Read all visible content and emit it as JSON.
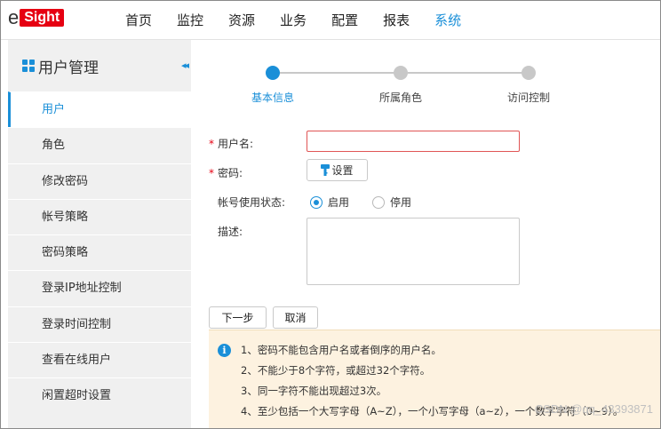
{
  "app": {
    "logo_prefix": "e",
    "logo_box": "Sight"
  },
  "nav": {
    "items": [
      "首页",
      "监控",
      "资源",
      "业务",
      "配置",
      "报表",
      "系统"
    ],
    "active_index": 6
  },
  "sidebar": {
    "title": "用户管理",
    "collapse_glyph": "◂◂",
    "items": [
      "用户",
      "角色",
      "修改密码",
      "帐号策略",
      "密码策略",
      "登录IP地址控制",
      "登录时间控制",
      "查看在线用户",
      "闲置超时设置"
    ],
    "active_index": 0
  },
  "steps": {
    "items": [
      "基本信息",
      "所属角色",
      "访问控制"
    ],
    "active_index": 0
  },
  "form": {
    "required_mark": "*",
    "username_label": "用户名:",
    "username_value": "",
    "password_label": "密码:",
    "set_button_label": "设置",
    "status_label": "帐号使用状态:",
    "status_options": [
      "启用",
      "停用"
    ],
    "status_selected": "启用",
    "description_label": "描述:",
    "description_value": ""
  },
  "actions": {
    "next_label": "下一步",
    "cancel_label": "取消"
  },
  "notice": {
    "icon_glyph": "i",
    "lines": [
      "1、密码不能包含用户名或者倒序的用户名。",
      "2、不能少于8个字符，或超过32个字符。",
      "3、同一字符不能出现超过3次。",
      "4、至少包括一个大写字母（A~Z），一个小写字母（a~z），一个数字字符（0~9）。"
    ]
  },
  "watermark": "CSDN @qq_43393871",
  "colors": {
    "accent": "#1a8fd8",
    "brand": "#e60012",
    "error_border": "#e05555",
    "notice_bg": "#fdf2e0"
  }
}
